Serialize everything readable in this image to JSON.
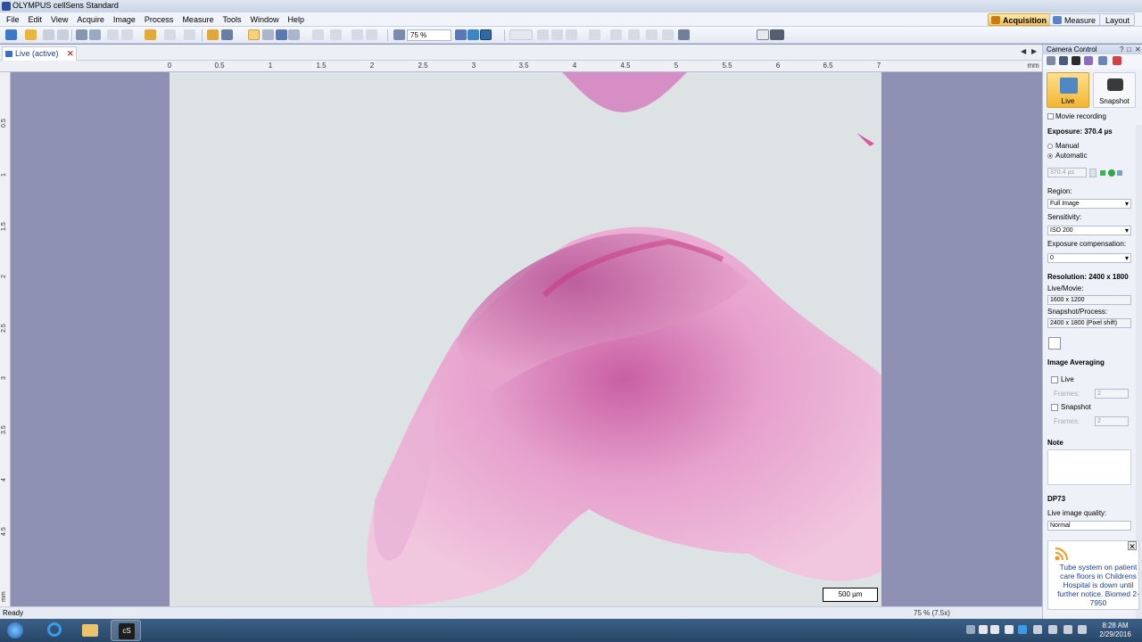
{
  "window": {
    "title": "OLYMPUS cellSens Standard"
  },
  "menu": [
    "File",
    "Edit",
    "View",
    "Acquire",
    "Image",
    "Process",
    "Measure",
    "Tools",
    "Window",
    "Help"
  ],
  "layouts": {
    "acquisition": "Acquisition",
    "measure": "Measure",
    "layout": "Layout"
  },
  "toolbar": {
    "zoom_value": "75 %"
  },
  "document": {
    "tab_label": "Live (active)",
    "close_glyph": "✕"
  },
  "ruler": {
    "h_labels": [
      "0",
      "0.5",
      "1",
      "1.5",
      "2",
      "2.5",
      "3",
      "3.5",
      "4",
      "4.5",
      "5",
      "5.5",
      "6",
      "6.5",
      "7"
    ],
    "unit": "mm",
    "v_labels": [
      "0.5",
      "1",
      "1.5",
      "2",
      "2.5",
      "3",
      "3.5",
      "4",
      "4.5",
      "mm"
    ]
  },
  "image": {
    "scale_bar": "500 µm"
  },
  "status": {
    "text": "Ready",
    "zoom": "75 % (7.5x)"
  },
  "panel": {
    "title": "Camera Control",
    "live_button": "Live",
    "snapshot_button": "Snapshot",
    "movie_recording": "Movie recording",
    "exposure_label": "Exposure: 370.4 µs",
    "exposure_manual": "Manual",
    "exposure_automatic": "Automatic",
    "exposure_value": "370.4 µs",
    "region_label": "Region:",
    "region_value": "Full Image",
    "sensitivity_label": "Sensitivity:",
    "sensitivity_value": "ISO 200",
    "exposure_comp_label": "Exposure compensation:",
    "exposure_comp_value": "0",
    "resolution_label": "Resolution: 2400 x 1800",
    "live_movie_label": "Live/Movie:",
    "live_movie_value": "1600 x 1200",
    "snapshot_process_label": "Snapshot/Process:",
    "snapshot_process_value": "2400 x 1800 (Pixel shift)",
    "image_averaging_title": "Image Averaging",
    "avg_live_label": "Live",
    "avg_live_frames": "2",
    "avg_snapshot_label": "Snapshot",
    "avg_snapshot_frames": "2",
    "frames_label": "Frames:",
    "note_title": "Note",
    "camera_title": "DP73",
    "live_quality_label": "Live image quality:",
    "live_quality_value": "Normal"
  },
  "notification": {
    "text": "Tube system on patient care floors in Childrens Hospital is down until further notice. Biomed 2-7950"
  },
  "clock": {
    "time": "8:28 AM",
    "date": "2/29/2016"
  },
  "colors": {
    "accent": "#f2b632",
    "brand": "#2f4f99",
    "viewport_bg": "#8e91b3"
  }
}
